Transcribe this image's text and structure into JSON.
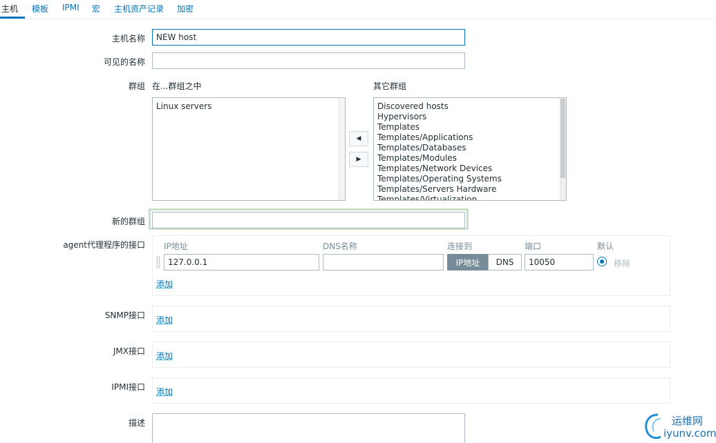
{
  "tabs": [
    {
      "label": "主机",
      "active": true
    },
    {
      "label": "模板"
    },
    {
      "label": "IPMI"
    },
    {
      "label": "宏"
    },
    {
      "label": "主机资产记录"
    },
    {
      "label": "加密"
    }
  ],
  "form": {
    "host_name_label": "主机名称",
    "host_name_value": "NEW host",
    "visible_name_label": "可见的名称",
    "visible_name_value": "",
    "groups_label": "群组",
    "in_groups_label": "在...群组之中",
    "other_groups_label": "其它群组",
    "in_groups": [
      "Linux servers"
    ],
    "other_groups": [
      "Discovered hosts",
      "Hypervisors",
      "Templates",
      "Templates/Applications",
      "Templates/Databases",
      "Templates/Modules",
      "Templates/Network Devices",
      "Templates/Operating Systems",
      "Templates/Servers Hardware",
      "Templates/Virtualization"
    ],
    "new_group_label": "新的群组",
    "new_group_value": "",
    "agent_iface_label": "agent代理程序的接口",
    "iface_headers": {
      "ip": "IP地址",
      "dns": "DNS名称",
      "connect": "连接到",
      "port": "端口",
      "default": "默认"
    },
    "agent_iface": {
      "ip": "127.0.0.1",
      "dns": "",
      "connect_ip": "IP地址",
      "connect_dns": "DNS",
      "port": "10050",
      "remove": "移除"
    },
    "add_label": "添加",
    "snmp_label": "SNMP接口",
    "jmx_label": "JMX接口",
    "ipmi_label": "IPMI接口",
    "description_label": "描述",
    "description_value": ""
  },
  "watermark": {
    "text": "运维网",
    "url_text": "iyunv.com"
  },
  "colors": {
    "link": "#0275b8",
    "text": "#1f2c33",
    "muted": "#768d99",
    "border": "#acbbc2",
    "focus_glow": "#c6e3c9"
  }
}
